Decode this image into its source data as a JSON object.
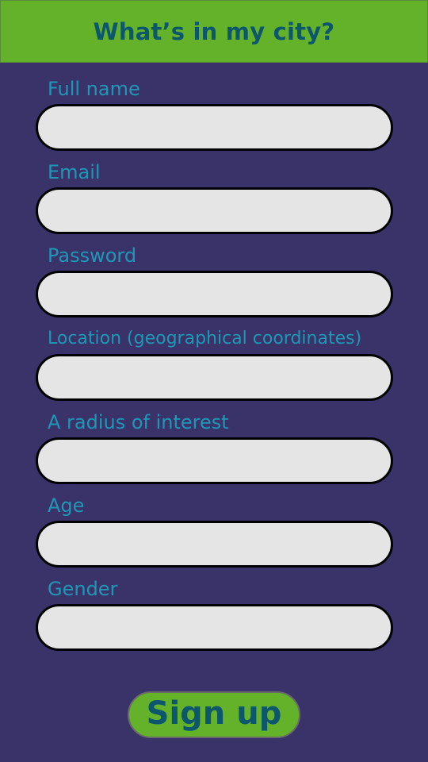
{
  "header": {
    "title": "What’s in my city?"
  },
  "form": {
    "fields": [
      {
        "label": "Full name",
        "value": ""
      },
      {
        "label": "Email",
        "value": ""
      },
      {
        "label": "Password",
        "value": ""
      },
      {
        "label": "Location (geographical coordinates)",
        "value": ""
      },
      {
        "label": "A radius of interest",
        "value": ""
      },
      {
        "label": "Age",
        "value": ""
      },
      {
        "label": "Gender",
        "value": ""
      }
    ],
    "submit_label": "Sign up"
  },
  "colors": {
    "background": "#3a336a",
    "accent_green": "#64b22a",
    "title_text": "#0c566e",
    "label_text": "#1f97b4",
    "input_fill": "#e5e5e5"
  }
}
